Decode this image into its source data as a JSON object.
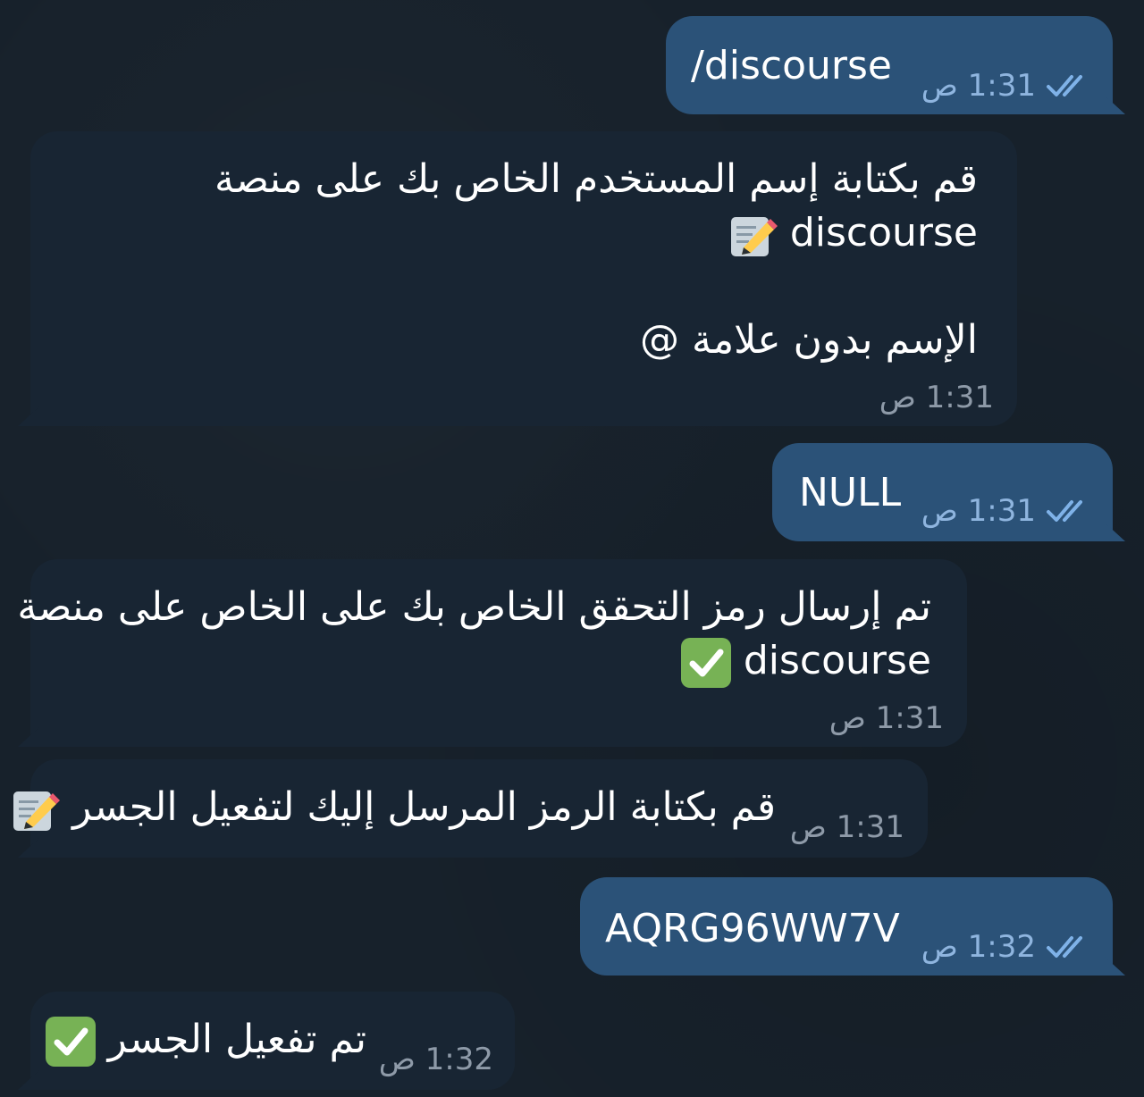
{
  "messages": [
    {
      "id": "m1",
      "direction": "outgoing",
      "lines": [
        "/discourse"
      ],
      "time": "1:31 ص",
      "status": "double-check-icon"
    },
    {
      "id": "m2",
      "direction": "incoming",
      "lines": [
        "قم بكتابة إسم المستخدم الخاص بك على منصة",
        "discourse",
        "الإسم بدون علامة @"
      ],
      "time": "1:31 ص",
      "emoji": "memo-pencil-icon"
    },
    {
      "id": "m3",
      "direction": "outgoing",
      "lines": [
        "NULL"
      ],
      "time": "1:31 ص",
      "status": "double-check-icon"
    },
    {
      "id": "m4",
      "direction": "incoming",
      "lines": [
        "تم إرسال رمز التحقق الخاص بك على الخاص على منصة",
        "discourse"
      ],
      "time": "1:31 ص",
      "emoji": "green-check-icon"
    },
    {
      "id": "m5",
      "direction": "incoming",
      "lines": [
        "قم بكتابة الرمز المرسل إليك لتفعيل الجسر"
      ],
      "time": "1:31 ص",
      "emoji": "memo-pencil-icon"
    },
    {
      "id": "m6",
      "direction": "outgoing",
      "lines": [
        "AQRG96WW7V"
      ],
      "time": "1:32 ص",
      "status": "double-check-icon"
    },
    {
      "id": "m7",
      "direction": "incoming",
      "lines": [
        "تم تفعيل الجسر"
      ],
      "time": "1:32 ص",
      "emoji": "green-check-icon"
    }
  ],
  "colors": {
    "background": "#17212b",
    "outgoing_bubble": "#2b5278",
    "incoming_bubble": "#182533",
    "outgoing_time": "#8fb5df",
    "incoming_time": "#8e9aa8",
    "checkmarks": "#7fb2e8",
    "emoji_green": "#77b255"
  }
}
